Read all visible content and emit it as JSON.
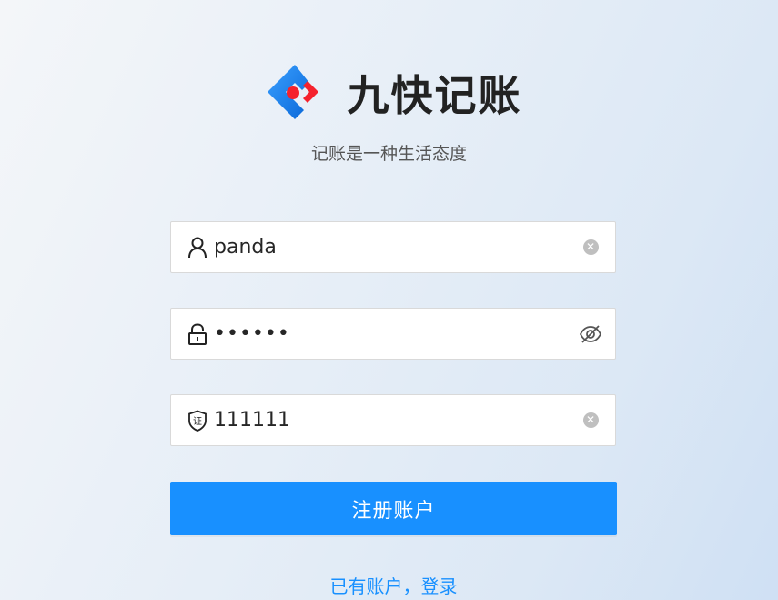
{
  "app": {
    "title": "九快记账",
    "tagline": "记账是一种生活态度"
  },
  "form": {
    "username": {
      "value": "panda",
      "prefix_icon": "user-icon",
      "suffix_icon": "clear-icon"
    },
    "password": {
      "value": "••••••",
      "prefix_icon": "lock-icon",
      "suffix_icon": "eye-invisible-icon"
    },
    "code": {
      "value": "111111",
      "prefix_icon": "certificate-shield-icon",
      "prefix_glyph": "证",
      "suffix_icon": "clear-icon"
    },
    "submit_label": "注册账户",
    "login_link": "已有账户，登录"
  },
  "colors": {
    "primary": "#1890ff",
    "logo_blue": "#1890ff",
    "logo_red": "#f5222d",
    "title_text": "#222222"
  }
}
